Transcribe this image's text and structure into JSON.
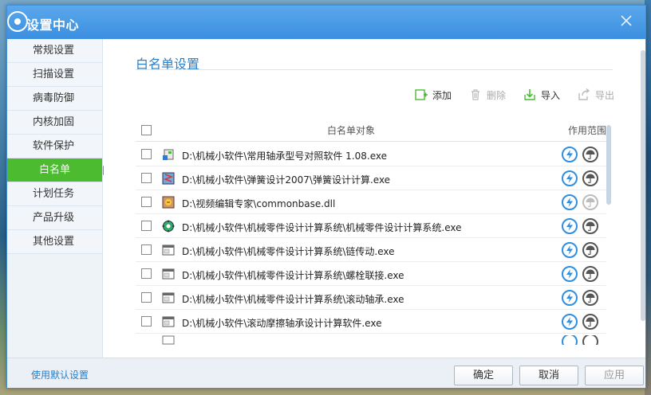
{
  "window": {
    "title": "设置中心"
  },
  "sidebar": {
    "items": [
      {
        "label": "常规设置",
        "active": false
      },
      {
        "label": "扫描设置",
        "active": false
      },
      {
        "label": "病毒防御",
        "active": false
      },
      {
        "label": "内核加固",
        "active": false
      },
      {
        "label": "软件保护",
        "active": false
      },
      {
        "label": "白名单",
        "active": true
      },
      {
        "label": "计划任务",
        "active": false
      },
      {
        "label": "产品升级",
        "active": false
      },
      {
        "label": "其他设置",
        "active": false
      }
    ]
  },
  "main": {
    "section_title": "白名单设置",
    "toolbar": {
      "add": "添加",
      "delete": "删除",
      "import": "导入",
      "export": "导出"
    },
    "table": {
      "col_object": "白名单对象",
      "col_scope": "作用范围",
      "rows": [
        {
          "path": "D:\\机械小软件\\常用轴承型号对照软件 1.08.exe",
          "icon": "app-icon-bearing",
          "umbrella_faded": false
        },
        {
          "path": "D:\\机械小软件\\弹簧设计2007\\弹簧设计计算.exe",
          "icon": "app-icon-spring",
          "umbrella_faded": false
        },
        {
          "path": "D:\\视频编辑专家\\commonbase.dll",
          "icon": "dll-icon",
          "umbrella_faded": true
        },
        {
          "path": "D:\\机械小软件\\机械零件设计计算系统\\机械零件设计计算系统.exe",
          "icon": "app-icon-gear",
          "umbrella_faded": false
        },
        {
          "path": "D:\\机械小软件\\机械零件设计计算系统\\链传动.exe",
          "icon": "exe-icon",
          "umbrella_faded": false
        },
        {
          "path": "D:\\机械小软件\\机械零件设计计算系统\\螺栓联接.exe",
          "icon": "exe-icon",
          "umbrella_faded": false
        },
        {
          "path": "D:\\机械小软件\\机械零件设计计算系统\\滚动轴承.exe",
          "icon": "exe-icon",
          "umbrella_faded": false
        },
        {
          "path": "D:\\机械小软件\\滚动摩擦轴承设计计算软件.exe",
          "icon": "exe-icon",
          "umbrella_faded": false
        }
      ]
    }
  },
  "footer": {
    "default_link": "使用默认设置",
    "ok": "确定",
    "cancel": "取消",
    "apply": "应用"
  },
  "colors": {
    "accent": "#3c8fe0",
    "active_green": "#4cbb30",
    "link_blue": "#2a7fc6"
  }
}
